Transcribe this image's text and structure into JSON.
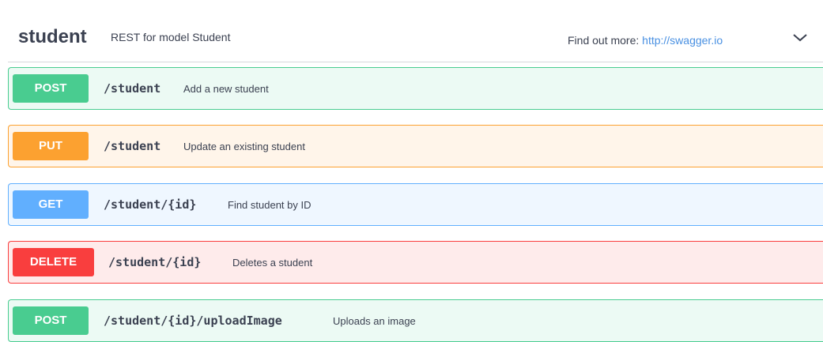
{
  "tag": {
    "name": "student",
    "description": "REST for model Student",
    "find_more_label": "Find out more:",
    "find_more_link": "http://swagger.io"
  },
  "operations": [
    {
      "method": "POST",
      "path": "/student",
      "summary": "Add a new student"
    },
    {
      "method": "PUT",
      "path": "/student",
      "summary": "Update an existing student"
    },
    {
      "method": "GET",
      "path": "/student/{id}",
      "summary": "Find student by ID"
    },
    {
      "method": "DELETE",
      "path": "/student/{id}",
      "summary": "Deletes a student"
    },
    {
      "method": "POST",
      "path": "/student/{id}/uploadImage",
      "summary": "Uploads an image"
    }
  ],
  "colors": {
    "post": "#49cc90",
    "put": "#fca130",
    "get": "#61affe",
    "delete": "#f93e3e",
    "link": "#4990e2"
  },
  "icons": {
    "collapse": "chevron-down-icon"
  }
}
